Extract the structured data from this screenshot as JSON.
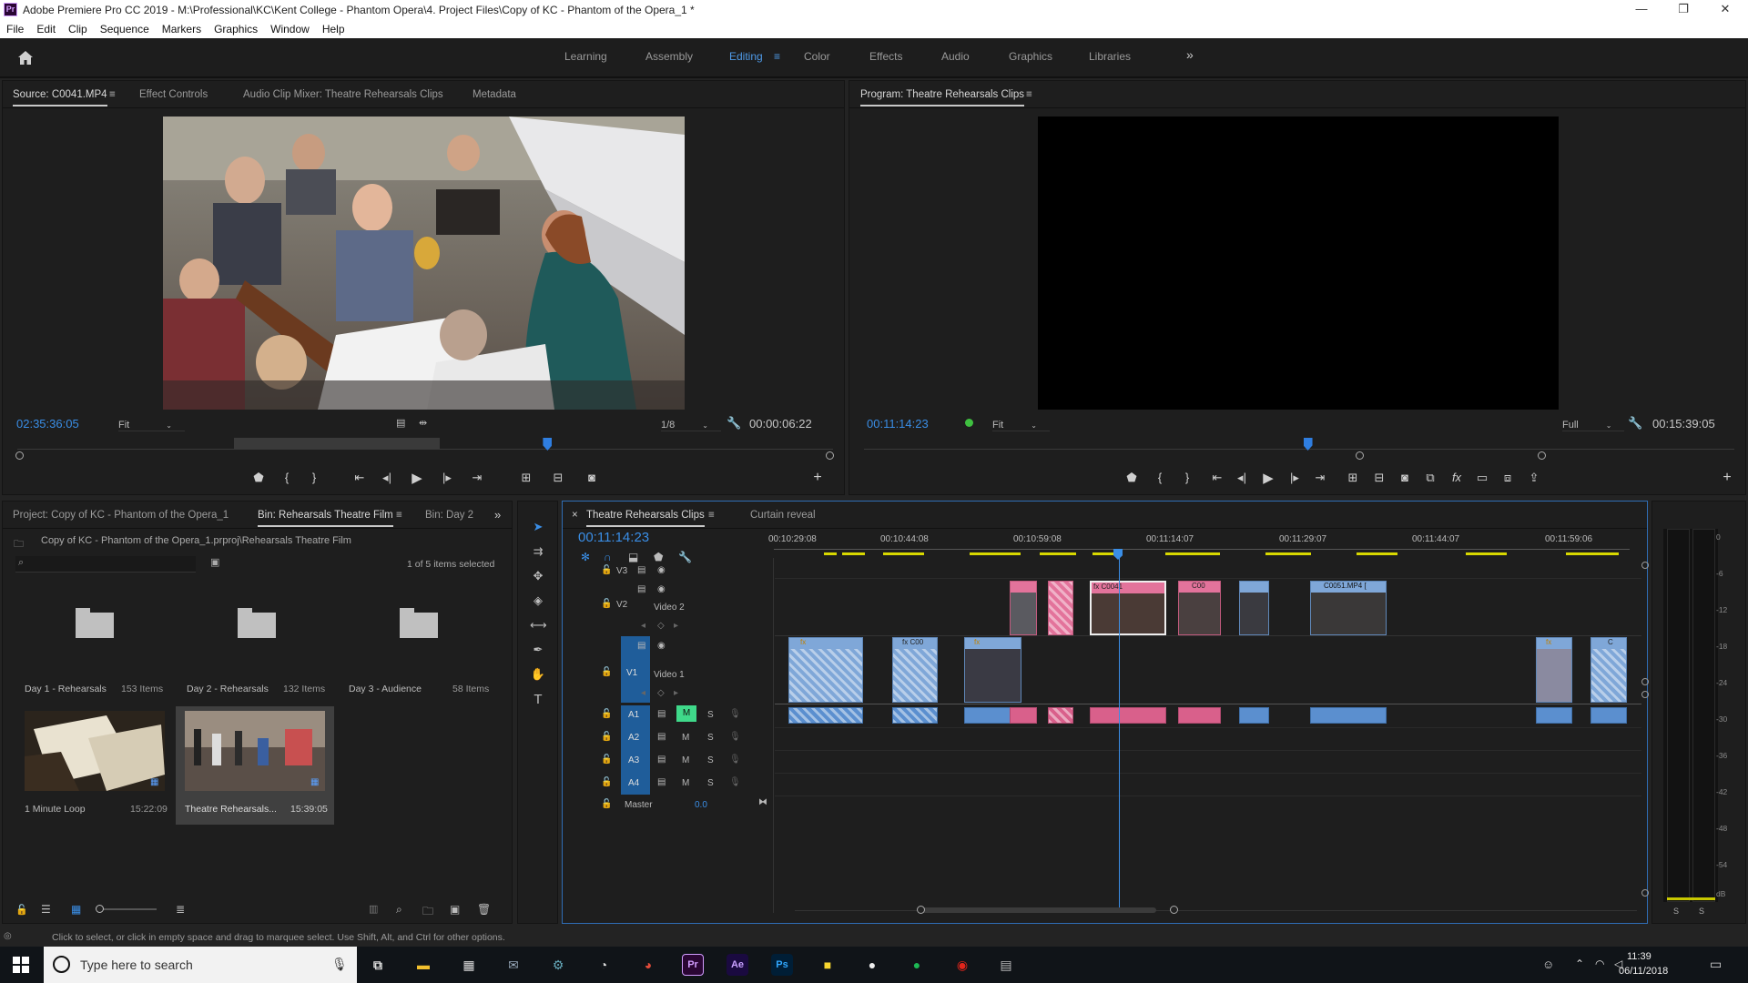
{
  "window": {
    "app_icon": "Pr",
    "title": "Adobe Premiere Pro CC 2019 - M:\\Professional\\KC\\Kent College - Phantom Opera\\4. Project Files\\Copy of KC - Phantom of the Opera_1 *",
    "minimize": "—",
    "restore": "❐",
    "close": "✕"
  },
  "menu": [
    "File",
    "Edit",
    "Clip",
    "Sequence",
    "Markers",
    "Graphics",
    "Window",
    "Help"
  ],
  "workspaces": {
    "items": [
      "Learning",
      "Assembly",
      "Editing",
      "Color",
      "Effects",
      "Audio",
      "Graphics",
      "Libraries"
    ],
    "active": "Editing",
    "more": "»",
    "menu_icon": "≡"
  },
  "source_panel": {
    "tabs": [
      "Source: C0041.MP4",
      "Effect Controls",
      "Audio Clip Mixer: Theatre Rehearsals Clips",
      "Metadata"
    ],
    "menu_icon": "≡",
    "timecode": "02:35:36:05",
    "fit": "Fit",
    "resolution": "1/8",
    "duration": "00:00:06:22",
    "playhead_fraction": 0.65
  },
  "program_panel": {
    "tab": "Program: Theatre Rehearsals Clips",
    "menu_icon": "≡",
    "timecode": "00:11:14:23",
    "fit": "Fit",
    "resolution": "Full",
    "duration": "00:15:39:05",
    "playhead_fraction": 0.51
  },
  "project_panel": {
    "tabs": [
      "Project: Copy of KC - Phantom of the Opera_1",
      "Bin: Rehearsals Theatre Film",
      "Bin: Day 2"
    ],
    "more": "»",
    "path": "Copy of KC - Phantom of the Opera_1.prproj\\Rehearsals Theatre Film",
    "selection": "1 of 5 items selected",
    "items": [
      {
        "name": "Day 1 - Rehearsals",
        "meta": "153 Items",
        "type": "folder"
      },
      {
        "name": "Day 2 - Rehearsals",
        "meta": "132 Items",
        "type": "folder"
      },
      {
        "name": "Day 3 - Audience",
        "meta": "58 Items",
        "type": "folder"
      },
      {
        "name": "1 Minute Loop",
        "meta": "15:22:09",
        "type": "sequence"
      },
      {
        "name": "Theatre Rehearsals...",
        "meta": "15:39:05",
        "type": "sequence"
      }
    ]
  },
  "timeline": {
    "tabs": [
      "Theatre Rehearsals Clips",
      "Curtain reveal"
    ],
    "close": "×",
    "menu_icon": "≡",
    "timecode": "00:11:14:23",
    "ruler": [
      "00:10:29:08",
      "00:10:44:08",
      "00:10:59:08",
      "00:11:14:07",
      "00:11:29:07",
      "00:11:44:07",
      "00:11:59:06"
    ],
    "tracks": {
      "v3": "V3",
      "v2": "V2",
      "v2_name": "Video 2",
      "v1": "V1",
      "v1_name": "Video 1",
      "a1": "A1",
      "a2": "A2",
      "a3": "A3",
      "a4": "A4",
      "master": "Master",
      "master_value": "0.0",
      "mute": "M",
      "solo": "S"
    },
    "clip_labels": {
      "c0041": "C0041",
      "c00": "C00",
      "c0051": "C0051.MP4 [",
      "fx": "fx",
      "c": "C"
    }
  },
  "audio_meter": {
    "scale": [
      "0",
      "-6",
      "-12",
      "-18",
      "-24",
      "-30",
      "-36",
      "-42",
      "-48",
      "-54",
      "dB"
    ],
    "solo": [
      "S",
      "S"
    ]
  },
  "status_bar": "Click to select, or click in empty space and drag to marquee select. Use Shift, Alt, and Ctrl for other options.",
  "taskbar": {
    "search_placeholder": "Type here to search",
    "time": "11:39",
    "date": "06/11/2018",
    "apps": [
      "task-view",
      "file-explorer",
      "calculator",
      "mail",
      "steam",
      "app-circle",
      "chrome",
      "premiere",
      "after-effects",
      "photoshop",
      "sticky-notes",
      "obs",
      "spotify",
      "creative-cloud",
      "folder-app"
    ]
  },
  "colors": {
    "accent": "#3a8ee6",
    "clip_video": "#7fa7d8",
    "clip_pink": "#e3739b",
    "clip_audio": "#5b8fcf",
    "panel_bg": "#1e1e1e",
    "timeline_border": "#2f6db5"
  }
}
